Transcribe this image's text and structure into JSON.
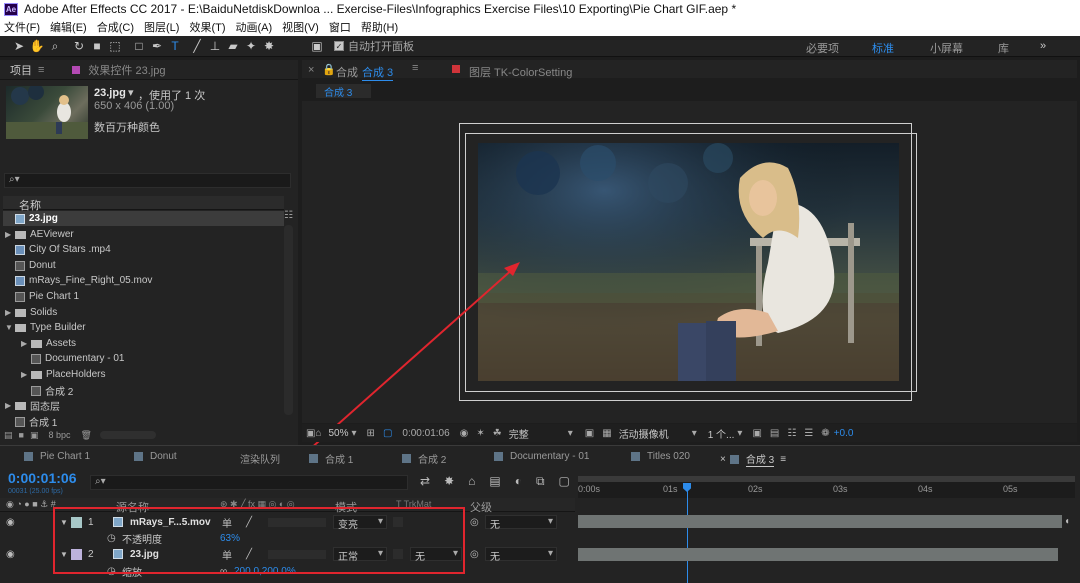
{
  "window": {
    "title": "Adobe After Effects CC 2017 - E:\\BaiduNetdiskDownloa ... Exercise-Files\\Infographics Exercise Files\\10 Exporting\\Pie Chart GIF.aep *",
    "logo": "Ae"
  },
  "menu": [
    "文件(F)",
    "编辑(E)",
    "合成(C)",
    "图层(L)",
    "效果(T)",
    "动画(A)",
    "视图(V)",
    "窗口",
    "帮助(H)"
  ],
  "toolbar": {
    "auto_open_label": "自动打开面板"
  },
  "workspaces": [
    {
      "label": "必要项",
      "active": false
    },
    {
      "label": "标准",
      "active": true
    },
    {
      "label": "小屏幕",
      "active": false
    },
    {
      "label": "库",
      "active": false
    }
  ],
  "project": {
    "tab": "项目",
    "effects_tab": "效果控件 23.jpg",
    "asset_name": "23.jpg",
    "asset_usage": "，使用了 1 次",
    "asset_dims": "650 x 406 (1.00)",
    "asset_colors": "数百万种颜色",
    "column_header": "名称",
    "bpc": "8 bpc",
    "items": [
      {
        "name": "23.jpg",
        "type": "img",
        "indent": 0,
        "selected": true
      },
      {
        "name": "AEViewer",
        "type": "folder",
        "indent": 0,
        "expandable": true
      },
      {
        "name": "City Of Stars .mp4",
        "type": "vid",
        "indent": 0
      },
      {
        "name": "Donut",
        "type": "comp",
        "indent": 0
      },
      {
        "name": "mRays_Fine_Right_05.mov",
        "type": "vid",
        "indent": 0
      },
      {
        "name": "Pie Chart 1",
        "type": "comp",
        "indent": 0
      },
      {
        "name": "Solids",
        "type": "folder",
        "indent": 0,
        "expandable": true
      },
      {
        "name": "Type Builder",
        "type": "folder",
        "indent": 0,
        "expanded": true
      },
      {
        "name": "Assets",
        "type": "folder",
        "indent": 1,
        "expandable": true
      },
      {
        "name": "Documentary - 01",
        "type": "comp",
        "indent": 1
      },
      {
        "name": "PlaceHolders",
        "type": "folder",
        "indent": 1,
        "expandable": true
      },
      {
        "name": "合成 2",
        "type": "comp",
        "indent": 1
      },
      {
        "name": "固态层",
        "type": "folder",
        "indent": 0,
        "expandable": true
      },
      {
        "name": "合成 1",
        "type": "comp",
        "indent": 0
      }
    ]
  },
  "composition": {
    "tab_prefix": "合成",
    "tab_name": "合成 3",
    "layer_tab": "图层 TK-ColorSetting",
    "breadcrumb": "合成 3",
    "zoom": "50%",
    "timecode": "0:00:01:06",
    "resolution": "完整",
    "camera": "活动摄像机",
    "views": "1 个...",
    "exposure": "+0.0"
  },
  "timeline": {
    "tabs": [
      {
        "label": "Pie Chart 1",
        "color": "#5e7487"
      },
      {
        "label": "Donut",
        "color": "#5e7487"
      },
      {
        "label": "渲染队列",
        "color": ""
      },
      {
        "label": "合成 1",
        "color": "#5e7487"
      },
      {
        "label": "合成 2",
        "color": "#5e7487"
      },
      {
        "label": "Documentary - 01",
        "color": "#5e7487"
      },
      {
        "label": "Titles 020",
        "color": "#5e7487"
      },
      {
        "label": "合成 3",
        "color": "#5e7487",
        "active": true
      }
    ],
    "timecode": "0:00:01:06",
    "timecode_sub": "00031 (25.00 fps)",
    "columns": {
      "name": "源名称",
      "mode": "模式",
      "trkmat": "T TrkMat",
      "parent": "父级"
    },
    "ruler": [
      "0:00s",
      "01s",
      "02s",
      "03s",
      "04s",
      "05s"
    ],
    "layers": [
      {
        "num": "1",
        "name": "mRays_F...5.mov",
        "mode": "变亮",
        "trkmat": "",
        "parent": "无",
        "color": "#a7c7c7"
      },
      {
        "num": "2",
        "name": "23.jpg",
        "mode": "正常",
        "trkmat": "无",
        "parent": "无",
        "color": "#bdb2dc"
      }
    ],
    "props": [
      {
        "label": "不透明度",
        "value": "63%"
      },
      {
        "label": "缩放",
        "value": "200.0,200.0%"
      }
    ],
    "playhead_fraction": 0.22
  }
}
